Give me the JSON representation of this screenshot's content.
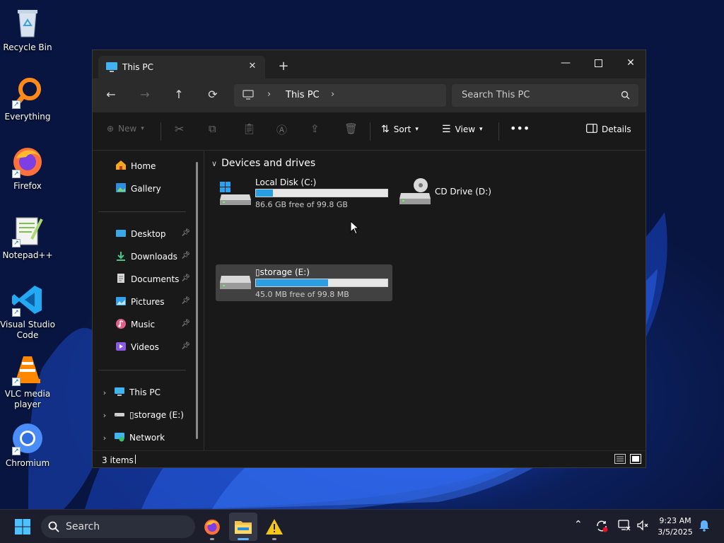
{
  "desktop": {
    "icons": [
      {
        "label": "Recycle Bin"
      },
      {
        "label": "Everything"
      },
      {
        "label": "Firefox"
      },
      {
        "label": "Notepad++"
      },
      {
        "label": "Visual Studio Code"
      },
      {
        "label": "VLC media player"
      },
      {
        "label": "Chromium"
      }
    ]
  },
  "window": {
    "tab_title": "This PC",
    "address": {
      "location": "This PC"
    },
    "search": {
      "placeholder": "Search This PC"
    },
    "toolbar": {
      "new_label": "New",
      "sort_label": "Sort",
      "view_label": "View",
      "details_label": "Details"
    },
    "sidebar": {
      "quick": [
        {
          "label": "Home"
        },
        {
          "label": "Gallery"
        }
      ],
      "pinned": [
        {
          "label": "Desktop"
        },
        {
          "label": "Downloads"
        },
        {
          "label": "Documents"
        },
        {
          "label": "Pictures"
        },
        {
          "label": "Music"
        },
        {
          "label": "Videos"
        }
      ],
      "tree": [
        {
          "label": "This PC"
        },
        {
          "label": "▯storage (E:)"
        },
        {
          "label": "Network"
        }
      ]
    },
    "content": {
      "group_title": "Devices and drives",
      "drives": [
        {
          "name": "Local Disk (C:)",
          "free_text": "86.6 GB free of 99.8 GB",
          "used_fraction": 0.13
        },
        {
          "name": "CD Drive (D:)"
        },
        {
          "name": "▯storage (E:)",
          "free_text": "45.0 MB free of 99.8 MB",
          "used_fraction": 0.55
        }
      ]
    },
    "status": {
      "item_count": "3 items"
    }
  },
  "taskbar": {
    "search_label": "Search",
    "clock_time": "9:23 AM",
    "clock_date": "3/5/2025"
  },
  "colors": {
    "accent": "#2a9ee3",
    "window_bg": "#191919",
    "taskbar_bg": "#1c1f2b"
  }
}
